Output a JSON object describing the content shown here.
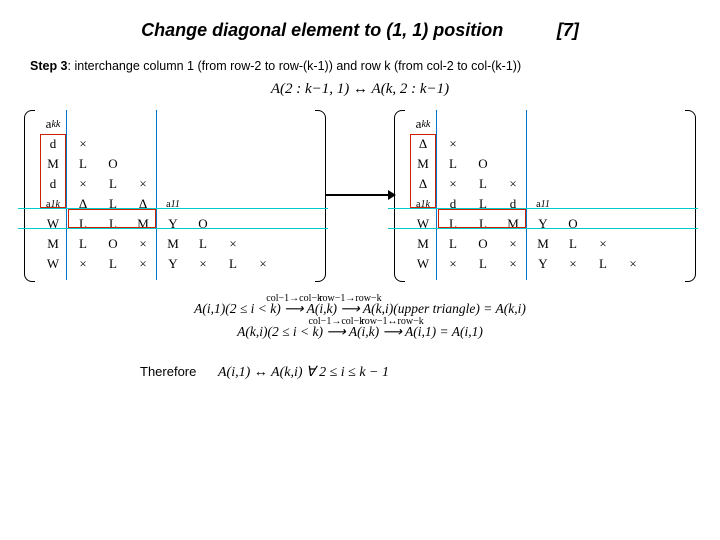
{
  "title": "Change diagonal element to (1, 1) position",
  "ref": "[7]",
  "step": {
    "label": "Step 3",
    "text": ": interchange column 1 (from row-2 to row-(k-1))   and row k (from col-2 to col-(k-1))"
  },
  "eq_top": "A(2 : k−1, 1) ↔ A(k, 2 : k−1)",
  "left_matrix": {
    "akk": "a",
    "akk_sub": "kk",
    "a1k": "a",
    "a1k_sub": "1k",
    "a11": "a",
    "a11_sub": "11",
    "rows": [
      [
        "d",
        "×",
        "",
        "",
        "",
        "",
        "",
        "",
        ""
      ],
      [
        "M",
        "L",
        "O",
        "",
        "",
        "",
        "",
        "",
        ""
      ],
      [
        "d",
        "×",
        "L",
        "×",
        "",
        "",
        "",
        "",
        ""
      ],
      [
        "",
        "Δ",
        "L",
        "Δ",
        "",
        "",
        "",
        "",
        ""
      ],
      [
        "W",
        "L",
        "L",
        "M",
        "Y",
        "O",
        "",
        "",
        ""
      ],
      [
        "M",
        "L",
        "O",
        "×",
        "M",
        "L",
        "×",
        "",
        ""
      ],
      [
        "W",
        "×",
        "L",
        "×",
        "Y",
        "×",
        "L",
        "×",
        ""
      ]
    ]
  },
  "right_matrix": {
    "akk": "a",
    "akk_sub": "kk",
    "a1k": "a",
    "a1k_sub": "1k",
    "a11": "a",
    "a11_sub": "11",
    "rows": [
      [
        "Δ",
        "×",
        "",
        "",
        "",
        "",
        "",
        "",
        ""
      ],
      [
        "M",
        "L",
        "O",
        "",
        "",
        "",
        "",
        "",
        ""
      ],
      [
        "Δ",
        "×",
        "L",
        "×",
        "",
        "",
        "",
        "",
        ""
      ],
      [
        "",
        "d",
        "L",
        "d",
        "",
        "",
        "",
        "",
        ""
      ],
      [
        "W",
        "L",
        "L",
        "M",
        "Y",
        "O",
        "",
        "",
        ""
      ],
      [
        "M",
        "L",
        "O",
        "×",
        "M",
        "L",
        "×",
        "",
        ""
      ],
      [
        "W",
        "×",
        "L",
        "×",
        "Y",
        "×",
        "L",
        "×",
        ""
      ]
    ]
  },
  "eq_lines": {
    "l1": "A(i,1)(2 ≤ i < k) ⟶ A(i,k) ⟶ A(k,i)(upper triangle) = A(k,i)",
    "l1_mid1": "col−1→col−k",
    "l1_mid2": "row−1→row−k",
    "l2": "A(k,i)(2 ≤ i < k) ⟶ A(i,k) ⟶ A(i,1) = A(i,1)",
    "l2_mid1": "col−1→col−k",
    "l2_mid2": "row−1↔row−k"
  },
  "therefore": {
    "label": "Therefore",
    "eq": "A(i,1) ↔ A(k,i)   ∀  2 ≤ i ≤ k − 1"
  }
}
